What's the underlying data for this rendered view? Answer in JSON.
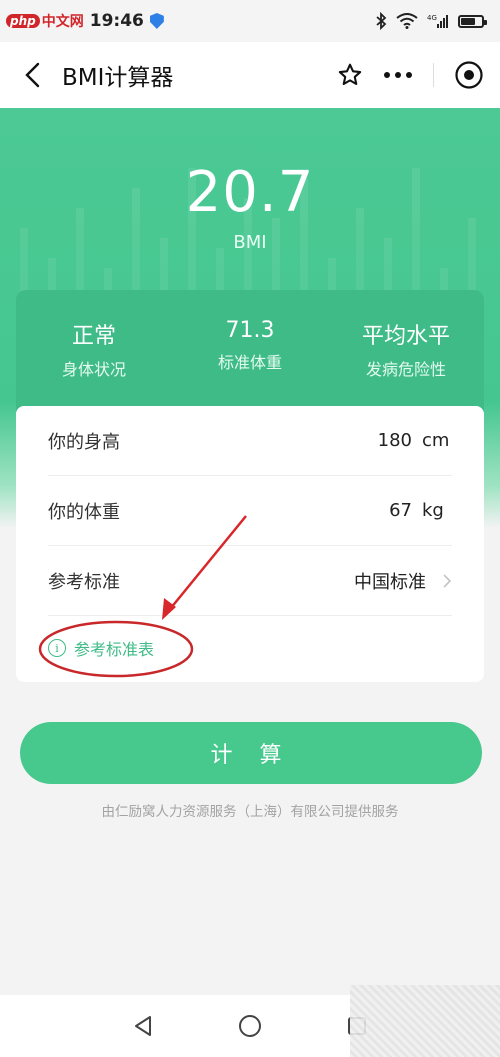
{
  "status_bar": {
    "watermark_php": "php",
    "watermark_text": "中文网",
    "time": "19:46",
    "network_label": "4G"
  },
  "nav": {
    "title": "BMI计算器"
  },
  "hero": {
    "bmi_value": "20.7",
    "bmi_label": "BMI"
  },
  "stats": [
    {
      "value": "正常",
      "label": "身体状况"
    },
    {
      "value": "71.3",
      "label": "标准体重"
    },
    {
      "value": "平均水平",
      "label": "发病危险性"
    }
  ],
  "form": {
    "height": {
      "label": "你的身高",
      "value": "180",
      "unit": "cm"
    },
    "weight": {
      "label": "你的体重",
      "value": "67",
      "unit": "kg"
    },
    "standard": {
      "label": "参考标准",
      "value": "中国标准"
    },
    "reference_link": "参考标准表"
  },
  "actions": {
    "calculate_label": "计 算"
  },
  "footer": {
    "provider": "由仁励窝人力资源服务（上海）有限公司提供服务"
  },
  "colors": {
    "brand_green": "#47c88d",
    "card_green": "#3fbb87",
    "annotation_red": "#d8262a"
  },
  "annotation": {
    "type": "arrow-and-ellipse",
    "target": "reference_link"
  }
}
